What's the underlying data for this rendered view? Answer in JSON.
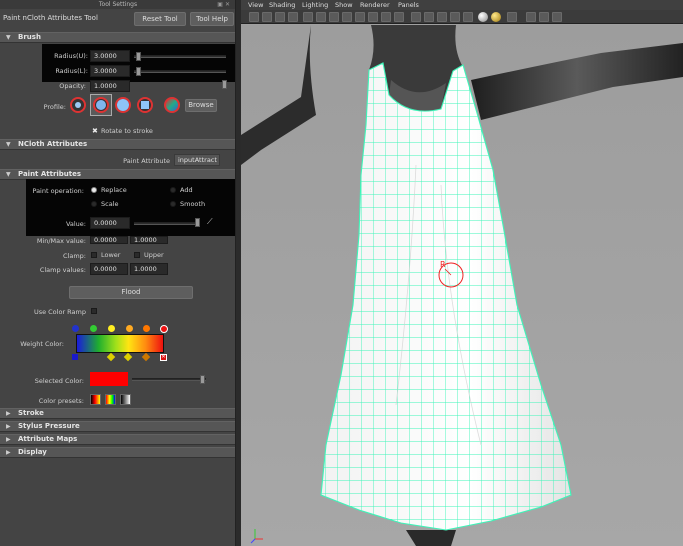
{
  "panel": {
    "window_title": "Tool Settings",
    "tool_name": "Paint nCloth Attributes Tool",
    "reset_label": "Reset Tool",
    "help_label": "Tool Help"
  },
  "brush": {
    "header": "Brush",
    "radius_u_label": "Radius(U):",
    "radius_u_value": "3.0000",
    "radius_l_label": "Radius(L):",
    "radius_l_value": "3.0000",
    "opacity_label": "Opacity:",
    "opacity_value": "1.0000",
    "profile_label": "Profile:",
    "browse_label": "Browse",
    "rotate_label": "Rotate to stroke"
  },
  "ncloth": {
    "header": "NCloth Attributes",
    "paint_attr_label": "Paint Attribute",
    "paint_attr_value": "inputAttract"
  },
  "paint_attrs": {
    "header": "Paint Attributes",
    "operation_label": "Paint operation:",
    "ops": [
      "Replace",
      "Add",
      "Scale",
      "Smooth"
    ],
    "value_label": "Value:",
    "value_value": "0.0000",
    "minmax_label": "Min/Max value:",
    "min_value": "0.0000",
    "max_value": "1.0000",
    "clamp_label": "Clamp:",
    "clamp_lower": "Lower",
    "clamp_upper": "Upper",
    "clamp_values_label": "Clamp values:",
    "clamp_min": "0.0000",
    "clamp_max": "1.0000",
    "flood_label": "Flood",
    "use_ramp_label": "Use Color Ramp",
    "weight_color_label": "Weight Color:",
    "selected_color_label": "Selected Color:",
    "color_presets_label": "Color presets:",
    "selected_color": "#ff0000"
  },
  "collapsed_sections": [
    "Stroke",
    "Stylus Pressure",
    "Attribute Maps",
    "Display"
  ],
  "viewport": {
    "menu": [
      "View",
      "Shading",
      "Lighting",
      "Show",
      "Renderer",
      "Panels"
    ],
    "brush_marker": "R",
    "mesh_color": "#3df5b8"
  }
}
